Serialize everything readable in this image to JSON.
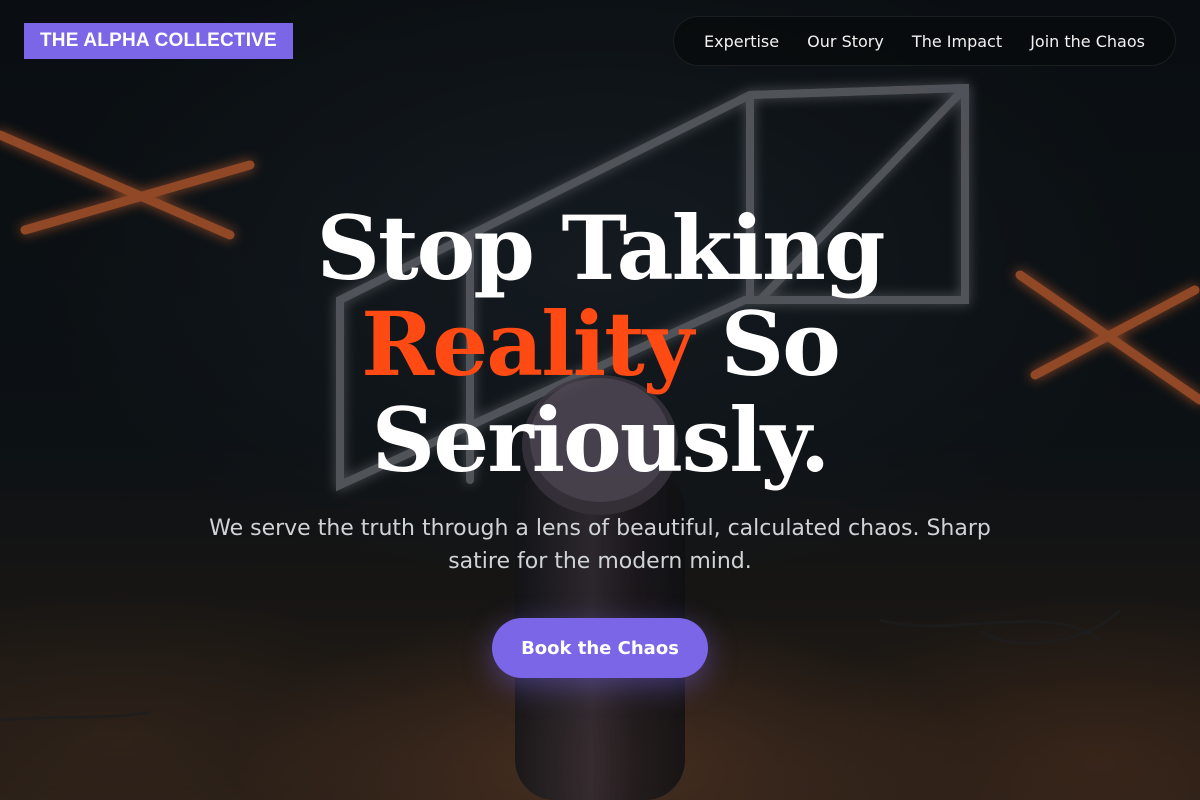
{
  "brand": {
    "name": "THE ALPHA COLLECTIVE"
  },
  "nav": {
    "items": [
      {
        "label": "Expertise"
      },
      {
        "label": "Our Story"
      },
      {
        "label": "The Impact"
      },
      {
        "label": "Join the Chaos"
      }
    ]
  },
  "hero": {
    "headline_line1": "Stop Taking",
    "headline_accent": "Reality",
    "headline_line2_rest": "So",
    "headline_line3": "Seriously.",
    "subtitle": "We serve the truth through a lens of beautiful, calculated chaos. Sharp satire for the modern mind.",
    "cta_label": "Book the Chaos",
    "background_image": "neon-microphone-stage-photo"
  },
  "colors": {
    "accent_purple": "#7b66e8",
    "accent_orange": "#ff4a14",
    "text_white": "#ffffff",
    "subtitle_gray": "#cfd3d6"
  }
}
